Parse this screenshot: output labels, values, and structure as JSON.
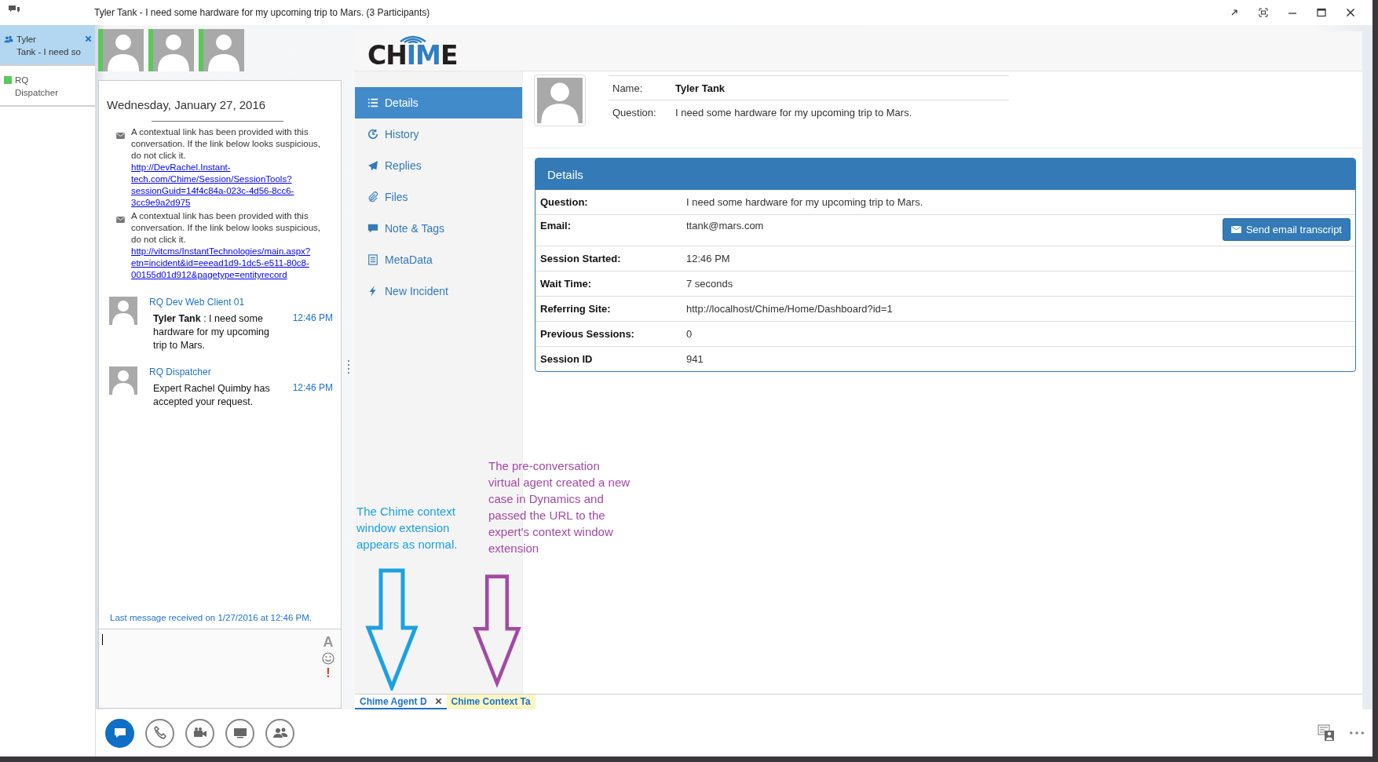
{
  "window": {
    "title": "Tyler Tank - I need some hardware for my upcoming trip to Mars. (3 Participants)"
  },
  "conversations": [
    {
      "kind": "group",
      "title": "Tyler\nTank - I need so",
      "selected": true,
      "closable": true
    },
    {
      "kind": "contact",
      "title": "RQ\nDispatcher",
      "selected": false,
      "color": "#5ac85a"
    }
  ],
  "participants": [
    {
      "color": "#5ac85a"
    },
    {
      "color": "#5ac85a"
    },
    {
      "color": "#5ac85a"
    }
  ],
  "chat": {
    "date": "Wednesday, January 27, 2016",
    "notices": [
      {
        "text": "A contextual link has been provided with this conversation. If the link below looks suspicious, do not click it.",
        "link": "http://DevRachel.Instant-tech.com/Chime/Session/SessionTools?sessionGuid=14f4c84a-023c-4d56-8cc6-3cc9e9a2d975"
      },
      {
        "text": "A contextual link has been provided with this conversation. If the link below looks suspicious, do not click it.",
        "link": "http://vitcms/InstantTechnologies/main.aspx?etn=incident&id=eeead1d9-1dc5-e511-80c8-00155d01d912&pagetype=entityrecord"
      }
    ],
    "messages": [
      {
        "sender": "RQ Dev Web Client 01",
        "time": "12:46 PM",
        "body": "**Tyler Tank** : I need some hardware for my upcoming trip to Mars."
      },
      {
        "sender": "RQ Dispatcher",
        "time": "12:46 PM",
        "body": "Expert Rachel Quimby has accepted your request."
      }
    ],
    "footer": "Last message received on 1/27/2016 at 12:46 PM."
  },
  "compose": {
    "font_button": "A",
    "priority_button": "!"
  },
  "toolbar": [
    {
      "kind": "im",
      "selected": true
    },
    {
      "kind": "phone",
      "selected": false
    },
    {
      "kind": "video",
      "selected": false
    },
    {
      "kind": "screen",
      "selected": false
    },
    {
      "kind": "people",
      "selected": false
    }
  ],
  "chime": {
    "logo": [
      {
        "text": "CH",
        "color": "#231f20"
      },
      {
        "text": "IM",
        "color": "#2f7fc1"
      },
      {
        "text": "E",
        "color": "#231f20"
      }
    ],
    "nav": [
      {
        "kind": "list",
        "label": "Details",
        "selected": true
      },
      {
        "kind": "history",
        "label": "History",
        "selected": false
      },
      {
        "kind": "send",
        "label": "Replies",
        "selected": false
      },
      {
        "kind": "clip",
        "label": "Files",
        "selected": false
      },
      {
        "kind": "comment",
        "label": "Note & Tags",
        "selected": false
      },
      {
        "kind": "doc",
        "label": "MetaData",
        "selected": false
      },
      {
        "kind": "bolt",
        "label": "New Incident",
        "selected": false
      }
    ],
    "profile": [
      {
        "label": "Name:",
        "value": "Tyler Tank",
        "bold": true
      },
      {
        "label": "Question:",
        "value": "I need some hardware for my upcoming trip to Mars.",
        "bold": false
      }
    ],
    "details": {
      "title": "Details",
      "rows": [
        {
          "label": "Question:",
          "value": "I need some hardware for my upcoming trip to Mars."
        },
        {
          "label": "Email:",
          "value": "ttank@mars.com",
          "action": "Send email transcript"
        },
        {
          "label": "Session Started:",
          "value": "12:46 PM"
        },
        {
          "label": "Wait Time:",
          "value": "7 seconds"
        },
        {
          "label": "Referring Site:",
          "value": "http://localhost/Chime/Home/Dashboard?id=1"
        },
        {
          "label": "Previous Sessions:",
          "value": "0"
        },
        {
          "label": "Session ID",
          "value": "941"
        }
      ]
    }
  },
  "annotations": [
    {
      "text": "The Chime context\nwindow extension\nappears as normal.",
      "color": "#1ba1e2"
    },
    {
      "text": "The pre-conversation\nvirtual agent created a new\ncase in Dynamics and\npassed the URL to the\nexpert's context window\nextension",
      "color": "#a349a4"
    }
  ],
  "tabs": [
    {
      "label": "Chime Agent D",
      "selected": true,
      "highlighted": false,
      "closable": true
    },
    {
      "label": "Chime Context Ta",
      "selected": false,
      "highlighted": true,
      "closable": false
    }
  ]
}
